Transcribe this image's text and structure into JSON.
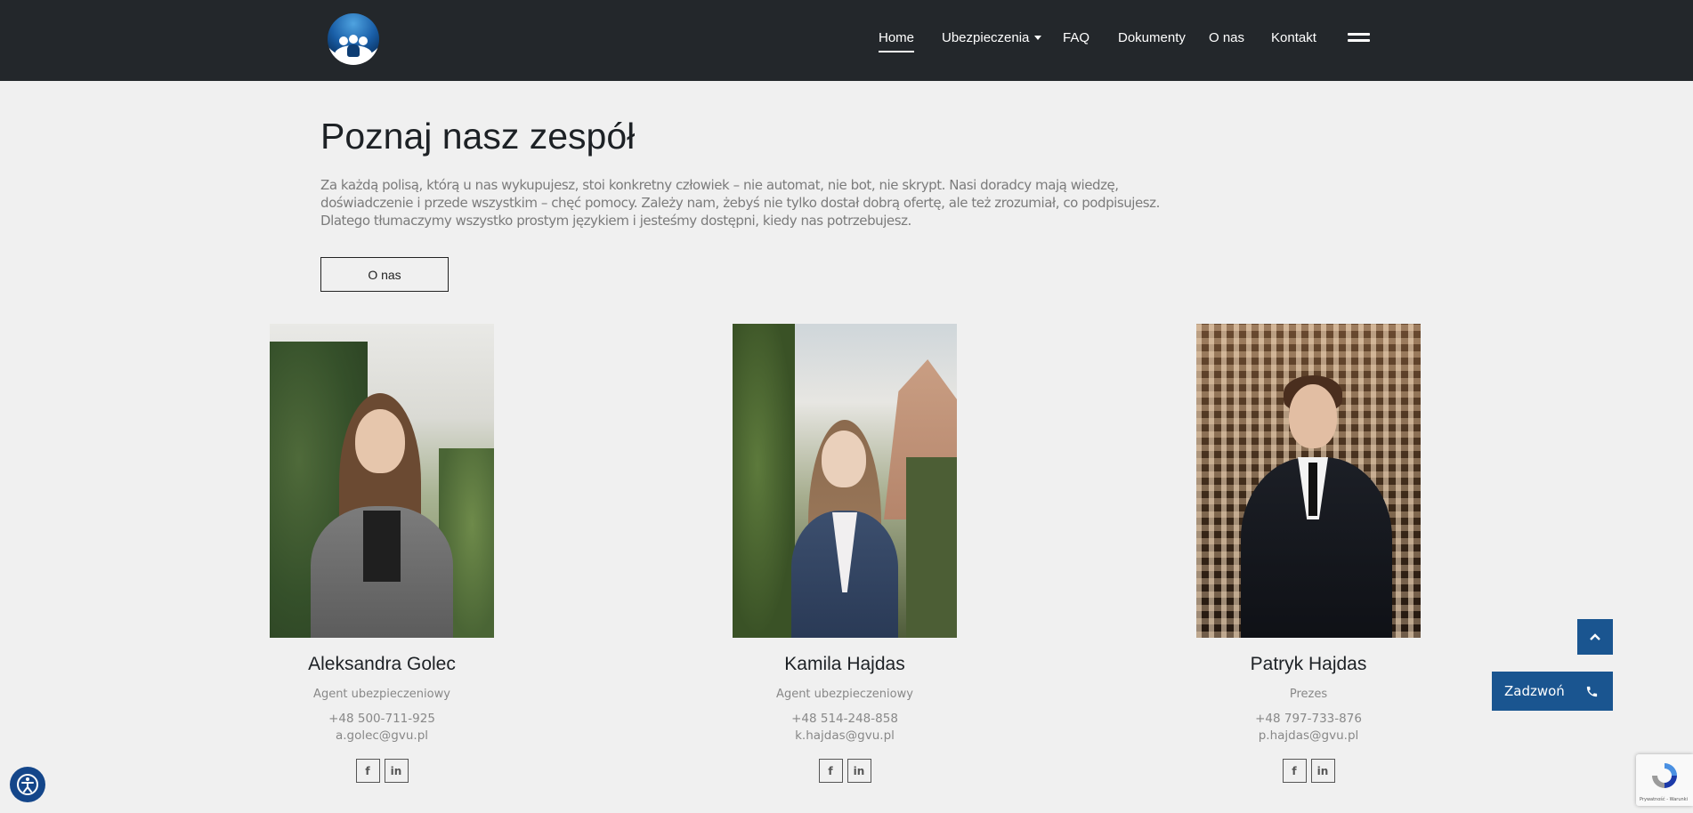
{
  "nav": {
    "items": [
      {
        "label": "Home",
        "active": true
      },
      {
        "label": "Ubezpieczenia",
        "dropdown": true
      },
      {
        "label": "FAQ"
      },
      {
        "label": "Dokumenty"
      },
      {
        "label": "O nas"
      },
      {
        "label": "Kontakt"
      }
    ]
  },
  "intro": {
    "title": "Poznaj nasz zespół",
    "text": "Za każdą polisą, którą u nas wykupujesz, stoi konkretny człowiek – nie automat, nie bot, nie skrypt. Nasi doradcy mają wiedzę, doświadczenie i przede wszystkim – chęć pomocy. Zależy nam, żebyś nie tylko dostał dobrą ofertę, ale też zrozumiał, co podpisujesz. Dlatego tłumaczymy wszystko prostym językiem i jesteśmy dostępni, kiedy nas potrzebujesz.",
    "button_label": "O nas"
  },
  "team": [
    {
      "name": "Aleksandra Golec",
      "role": "Agent ubezpieczeniowy",
      "phone": "+48 500-711-925",
      "email": "a.golec@gvu.pl"
    },
    {
      "name": "Kamila Hajdas",
      "role": "Agent ubezpieczeniowy",
      "phone": "+48 514-248-858",
      "email": "k.hajdas@gvu.pl"
    },
    {
      "name": "Patryk Hajdas",
      "role": "Prezes",
      "phone": "+48 797-733-876",
      "email": "p.hajdas@gvu.pl"
    }
  ],
  "social": {
    "facebook": "f",
    "linkedin": "in"
  },
  "floating": {
    "call_label": "Zadzwoń",
    "recaptcha_text": "Prywatność - Warunki"
  },
  "colors": {
    "header_bg": "#23272b",
    "accent": "#1a5590",
    "page_bg": "#f0f0f0"
  }
}
